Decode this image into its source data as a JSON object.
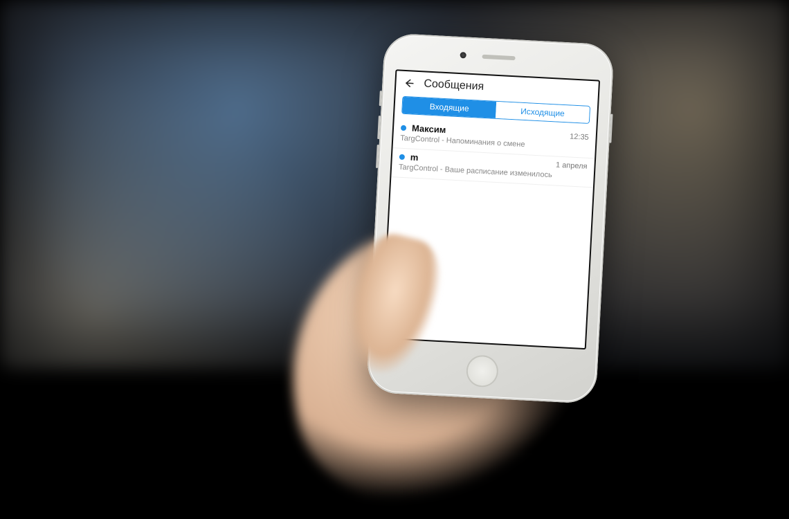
{
  "header": {
    "title": "Сообщения"
  },
  "tabs": {
    "incoming": "Входящие",
    "outgoing": "Исходящие"
  },
  "messages": [
    {
      "sender": "Максим",
      "time": "12:35",
      "preview": "TargControl - Напоминания о смене"
    },
    {
      "sender": "m",
      "time": "1 апреля",
      "preview": "TargControl - Ваше расписание изменилось"
    }
  ],
  "colors": {
    "accent": "#1f8fe6"
  }
}
